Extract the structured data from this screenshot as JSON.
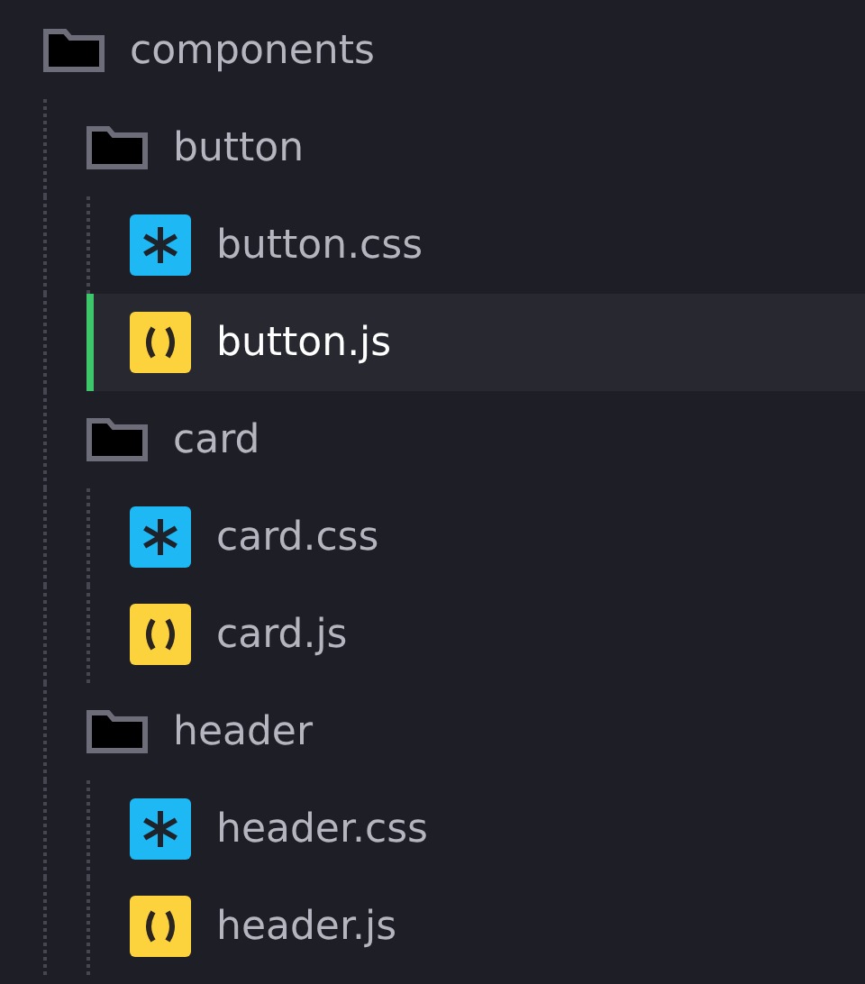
{
  "tree": [
    {
      "name": "components",
      "kind": "folder",
      "selected": false,
      "children": [
        {
          "name": "button",
          "kind": "folder",
          "selected": false,
          "children": [
            {
              "name": "button.css",
              "kind": "css",
              "selected": false
            },
            {
              "name": "button.js",
              "kind": "js",
              "selected": true
            }
          ]
        },
        {
          "name": "card",
          "kind": "folder",
          "selected": false,
          "children": [
            {
              "name": "card.css",
              "kind": "css",
              "selected": false
            },
            {
              "name": "card.js",
              "kind": "js",
              "selected": false
            }
          ]
        },
        {
          "name": "header",
          "kind": "folder",
          "selected": false,
          "children": [
            {
              "name": "header.css",
              "kind": "css",
              "selected": false
            },
            {
              "name": "header.js",
              "kind": "js",
              "selected": false
            }
          ]
        }
      ]
    }
  ]
}
